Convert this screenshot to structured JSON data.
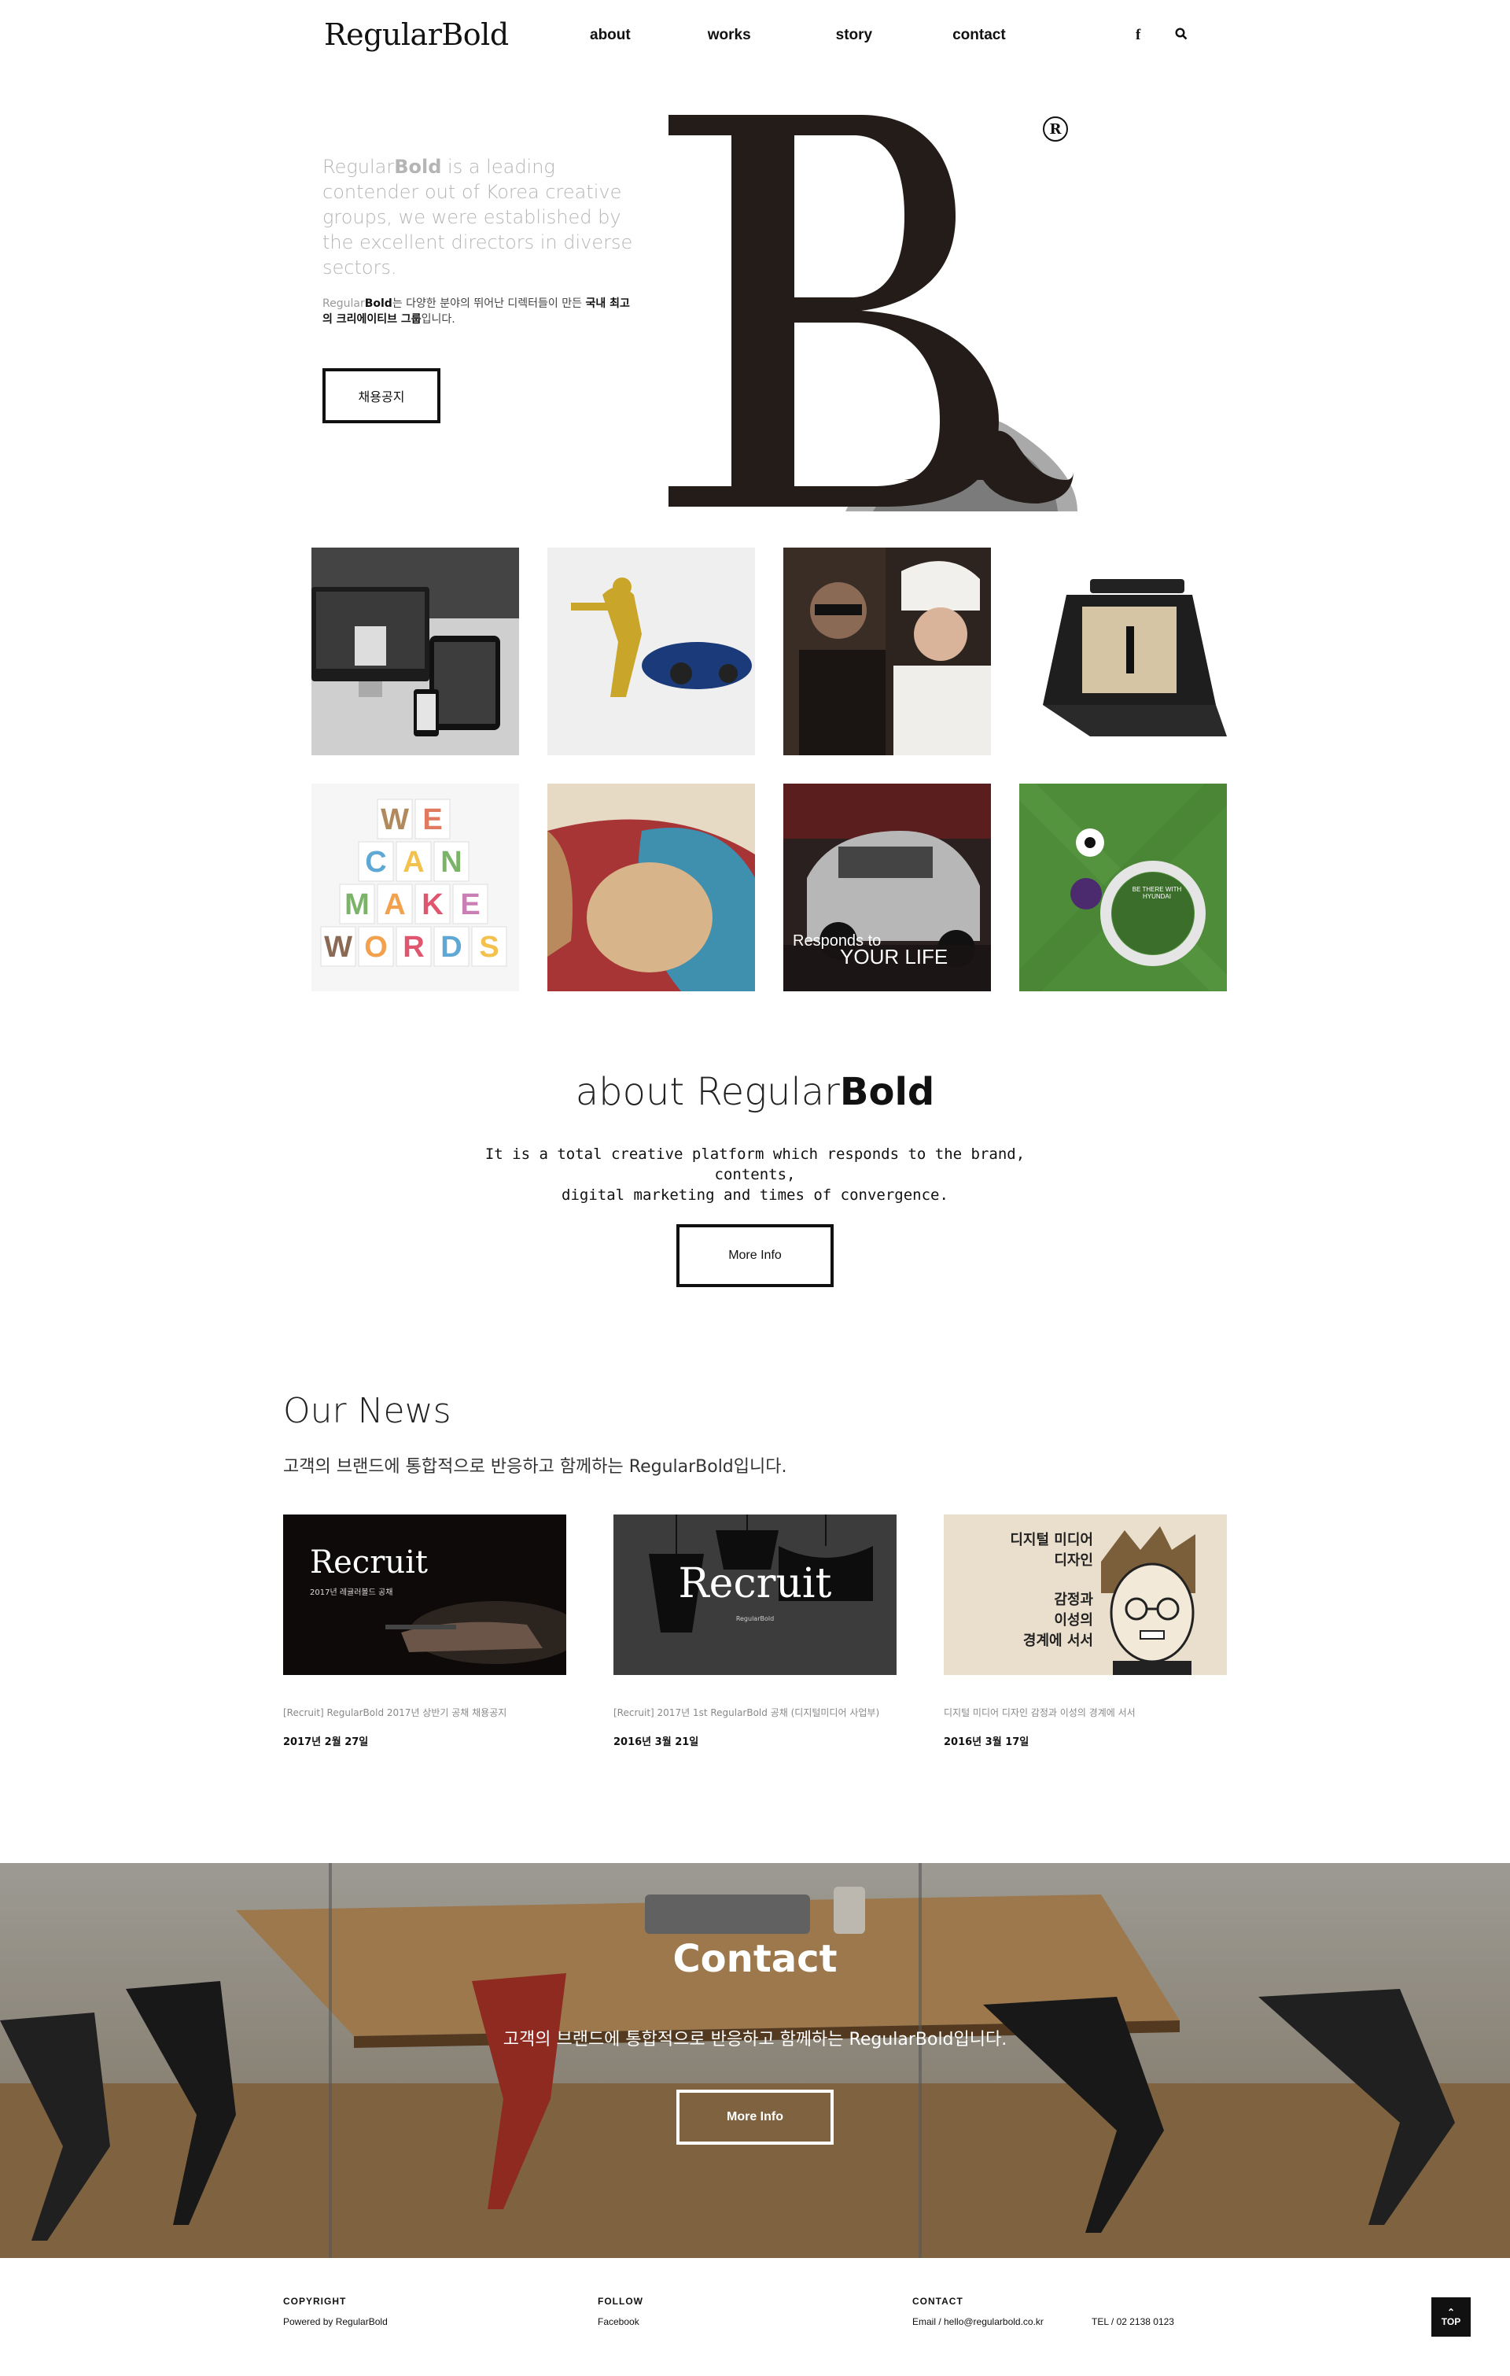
{
  "header": {
    "logo": "RegularBold",
    "nav": [
      "about",
      "works",
      "story",
      "contact"
    ],
    "icons": [
      "facebook-icon",
      "search-icon"
    ]
  },
  "hero": {
    "intro_en_brand_regular": "Regular",
    "intro_en_brand_bold": "Bold",
    "intro_en_rest": " is a leading contender out of Korea creative groups, we were established by the excellent directors in diverse sectors.",
    "intro_ko_brand_regular": "Regular",
    "intro_ko_brand_bold": "Bold",
    "intro_ko_mid": "는 다양한 분야의 뛰어난 디렉터들이 만든 ",
    "intro_ko_bold": "국내 최고의 크리에이티브 그룹",
    "intro_ko_end": "입니다.",
    "recruit_button": "채용공지",
    "registered_mark": "R"
  },
  "works": {
    "items": [
      {
        "name": "devices-mockup"
      },
      {
        "name": "superhero-car"
      },
      {
        "name": "fashion-couple"
      },
      {
        "name": "product-box"
      },
      {
        "name": "we-can-make-words"
      },
      {
        "name": "illustration-pool"
      },
      {
        "name": "car-responds",
        "text_line1": "Responds to",
        "text_line2": "YOUR LIFE"
      },
      {
        "name": "soccer-field",
        "badge_text": "BE THERE WITH HYUNDAI"
      }
    ]
  },
  "about": {
    "title_regular": "about Regular",
    "title_bold": "Bold",
    "desc_line1": "It is a total creative platform which responds to the brand, contents,",
    "desc_line2": "digital marketing and times of convergence.",
    "button": "More Info"
  },
  "news": {
    "title": "Our News",
    "subtitle": "고객의 브랜드에 통합적으로 반응하고 함께하는 RegularBold입니다.",
    "items": [
      {
        "image_title": "Recruit",
        "image_sub": "2017년 레귤러볼드 공채",
        "caption": "[Recruit] RegularBold 2017년 상반기 공채 채용공지",
        "date": "2017년 2월 27일"
      },
      {
        "image_title": "Recruit",
        "image_sub": "RegularBold",
        "caption": "[Recruit] 2017년 1st RegularBold 공채 (디지털미디어 사업부)",
        "date": "2016년 3월 21일"
      },
      {
        "image_line1": "디지털 미디어",
        "image_line2": "디자인",
        "image_line3": "감정과",
        "image_line4": "이성의",
        "image_line5": "경계에 서서",
        "caption": "디지털 미디어 디자인 감정과 이성의 경계에 서서",
        "date": "2016년 3월 17일"
      }
    ]
  },
  "contact": {
    "title": "Contact",
    "subtitle": "고객의 브랜드에 통합적으로 반응하고 함께하는 RegularBold입니다.",
    "button": "More Info"
  },
  "footer": {
    "copyright_label": "COPYRIGHT",
    "copyright_value": "Powered by RegularBold",
    "follow_label": "FOLLOW",
    "follow_value": "Facebook",
    "contact_label": "CONTACT",
    "email": "Email / hello@regularbold.co.kr",
    "tel": "TEL / 02 2138 0123",
    "top_button": "TOP"
  }
}
